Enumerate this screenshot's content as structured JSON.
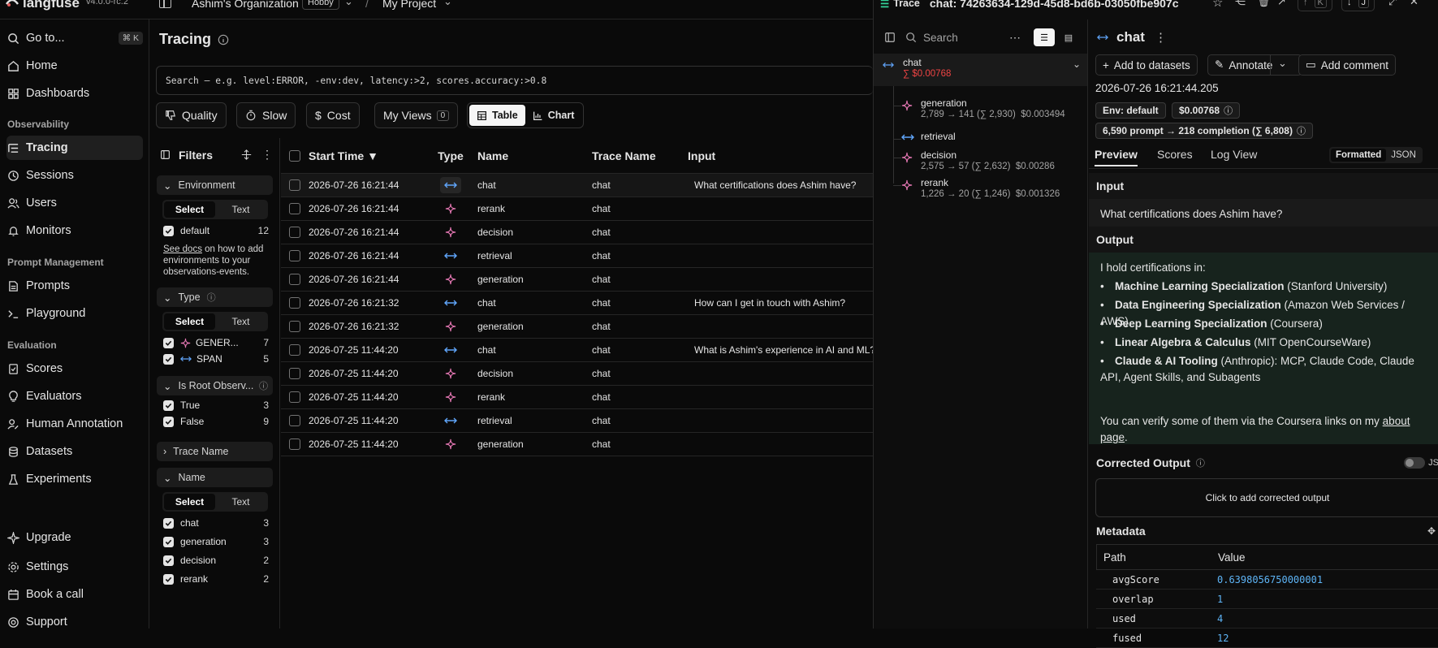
{
  "topbar": {
    "logo": "langfuse",
    "version": "v4.0.0-rc.2",
    "org": "Ashim's Organization",
    "plan": "Hobby",
    "project": "My Project"
  },
  "sidebar": {
    "goto": "Go to...",
    "goto_shortcut": "⌘ K",
    "home": "Home",
    "dashboards": "Dashboards",
    "sec_observability": "Observability",
    "tracing": "Tracing",
    "sessions": "Sessions",
    "users": "Users",
    "monitors": "Monitors",
    "sec_prompt": "Prompt Management",
    "prompts": "Prompts",
    "playground": "Playground",
    "sec_eval": "Evaluation",
    "scores": "Scores",
    "evaluators": "Evaluators",
    "human_annotation": "Human Annotation",
    "datasets": "Datasets",
    "experiments": "Experiments",
    "upgrade": "Upgrade",
    "settings": "Settings",
    "book_call": "Book a call",
    "support": "Support"
  },
  "main": {
    "title": "Tracing",
    "search_placeholder": "Search — e.g. level:ERROR, -env:dev, latency:>2, scores.accuracy:>0.8",
    "quality": "Quality",
    "slow": "Slow",
    "cost": "Cost",
    "my_views": "My Views",
    "my_views_count": "0",
    "table_btn": "Table",
    "chart_btn": "Chart"
  },
  "filters": {
    "title": "Filters",
    "environment": "Environment",
    "select": "Select",
    "text": "Text",
    "env_default": "default",
    "env_default_count": "12",
    "see_docs": "See docs",
    "docs_rest": " on how to add environments to your observations-events.",
    "type": "Type",
    "type_gen": "GENER...",
    "type_gen_count": "7",
    "type_span": "SPAN",
    "type_span_count": "5",
    "is_root": "Is Root Observ...",
    "root_true": "True",
    "root_true_count": "3",
    "root_false": "False",
    "root_false_count": "9",
    "trace_name": "Trace Name",
    "name": "Name",
    "names": [
      {
        "label": "chat",
        "count": "3"
      },
      {
        "label": "generation",
        "count": "3"
      },
      {
        "label": "decision",
        "count": "2"
      },
      {
        "label": "rerank",
        "count": "2"
      }
    ]
  },
  "table": {
    "headers": {
      "start": "Start Time ▼",
      "type": "Type",
      "name": "Name",
      "trace": "Trace Name",
      "input": "Input"
    },
    "rows": [
      {
        "start": "2026-07-26 16:21:44",
        "type": "span",
        "name": "chat",
        "trace": "chat",
        "input": "What certifications does Ashim have?"
      },
      {
        "start": "2026-07-26 16:21:44",
        "type": "gen",
        "name": "rerank",
        "trace": "chat",
        "input": ""
      },
      {
        "start": "2026-07-26 16:21:44",
        "type": "gen",
        "name": "decision",
        "trace": "chat",
        "input": ""
      },
      {
        "start": "2026-07-26 16:21:44",
        "type": "span",
        "name": "retrieval",
        "trace": "chat",
        "input": ""
      },
      {
        "start": "2026-07-26 16:21:44",
        "type": "gen",
        "name": "generation",
        "trace": "chat",
        "input": ""
      },
      {
        "start": "2026-07-26 16:21:32",
        "type": "span",
        "name": "chat",
        "trace": "chat",
        "input": "How can I get in touch with Ashim?"
      },
      {
        "start": "2026-07-26 16:21:32",
        "type": "gen",
        "name": "generation",
        "trace": "chat",
        "input": ""
      },
      {
        "start": "2026-07-25 11:44:20",
        "type": "span",
        "name": "chat",
        "trace": "chat",
        "input": "What is Ashim's experience in AI and ML?"
      },
      {
        "start": "2026-07-25 11:44:20",
        "type": "gen",
        "name": "decision",
        "trace": "chat",
        "input": ""
      },
      {
        "start": "2026-07-25 11:44:20",
        "type": "gen",
        "name": "rerank",
        "trace": "chat",
        "input": ""
      },
      {
        "start": "2026-07-25 11:44:20",
        "type": "span",
        "name": "retrieval",
        "trace": "chat",
        "input": ""
      },
      {
        "start": "2026-07-25 11:44:20",
        "type": "gen",
        "name": "generation",
        "trace": "chat",
        "input": ""
      }
    ]
  },
  "trace": {
    "badge": "Trace",
    "id": "chat: 74263634-129d-45d8-bd6b-03050fbe907c",
    "kbd_k": "K",
    "kbd_j": "J",
    "search_placeholder": "Search",
    "root_name": "chat",
    "root_cost": "∑ $0.00768",
    "children": [
      {
        "name": "generation",
        "meta": "2,789 → 141 (∑ 2,930)  $0.003494",
        "type": "gen"
      },
      {
        "name": "retrieval",
        "meta": "",
        "type": "span"
      },
      {
        "name": "decision",
        "meta": "2,575 → 57 (∑ 2,632)  $0.00286",
        "type": "gen"
      },
      {
        "name": "rerank",
        "meta": "1,226 → 20 (∑ 1,246)  $0.001326",
        "type": "gen"
      }
    ]
  },
  "detail": {
    "title": "chat",
    "add_datasets": "Add to datasets",
    "annotate": "Annotate",
    "add_comment": "Add comment",
    "timestamp": "2026-07-26 16:21:44.205",
    "env_chip": "Env: default",
    "cost_chip": "$0.00768",
    "tokens_chip": "6,590 prompt → 218 completion (∑ 6,808)",
    "tab_preview": "Preview",
    "tab_scores": "Scores",
    "tab_log": "Log View",
    "formatted": "Formatted",
    "json": "JSON",
    "input_label": "Input",
    "input_text": "What certifications does Ashim have?",
    "output_label": "Output",
    "output_intro": "I hold certifications in:",
    "output_items": [
      {
        "bold": "Machine Learning Specialization",
        "rest": " (Stanford University)"
      },
      {
        "bold": "Data Engineering Specialization",
        "rest": " (Amazon Web Services / AWS)"
      },
      {
        "bold": "Deep Learning Specialization",
        "rest": " (Coursera)"
      },
      {
        "bold": "Linear Algebra & Calculus",
        "rest": " (MIT OpenCourseWare)"
      },
      {
        "bold": "Claude & AI Tooling",
        "rest": " (Anthropic): MCP, Claude Code, Claude API, Agent Skills, and Subagents"
      }
    ],
    "output_outro": "You can verify some of them via the Coursera links on my ",
    "output_link": "about page",
    "output_end": ".",
    "corrected_label": "Corrected Output",
    "corrected_toggle_label": "JS",
    "corrected_placeholder": "Click to add corrected output",
    "metadata_label": "Metadata",
    "meta_path": "Path",
    "meta_value": "Value",
    "metadata": [
      {
        "k": "avgScore",
        "v": "0.6398056750000001"
      },
      {
        "k": "overlap",
        "v": "1"
      },
      {
        "k": "used",
        "v": "4"
      },
      {
        "k": "fused",
        "v": "12"
      }
    ]
  }
}
